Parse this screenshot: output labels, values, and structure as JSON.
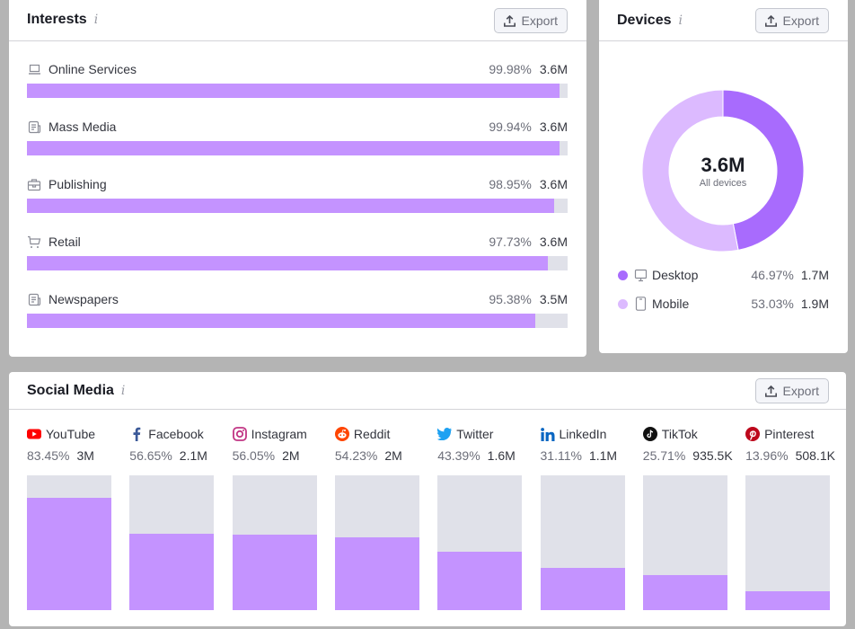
{
  "colors": {
    "bar_fill": "#c493ff",
    "bar_track": "#e0e1e9",
    "desktop": "#a86bfd",
    "mobile": "#dcbaff"
  },
  "interests": {
    "title": "Interests",
    "info_icon": "info-icon",
    "export_label": "Export",
    "items": [
      {
        "label": "Online Services",
        "icon": "laptop-icon",
        "percent": "99.98%",
        "value": "3.6M",
        "share": 99.98
      },
      {
        "label": "Mass Media",
        "icon": "news-icon",
        "percent": "99.94%",
        "value": "3.6M",
        "share": 99.94
      },
      {
        "label": "Publishing",
        "icon": "briefcase-icon",
        "percent": "98.95%",
        "value": "3.6M",
        "share": 98.95
      },
      {
        "label": "Retail",
        "icon": "cart-icon",
        "percent": "97.73%",
        "value": "3.6M",
        "share": 97.73
      },
      {
        "label": "Newspapers",
        "icon": "news-icon",
        "percent": "95.38%",
        "value": "3.5M",
        "share": 95.38
      }
    ]
  },
  "devices": {
    "title": "Devices",
    "info_icon": "info-icon",
    "export_label": "Export",
    "total": "3.6M",
    "total_label": "All devices",
    "items": [
      {
        "label": "Desktop",
        "icon": "desktop-icon",
        "percent": "46.97%",
        "value": "1.7M",
        "share": 46.97,
        "color": "#a86bfd"
      },
      {
        "label": "Mobile",
        "icon": "mobile-icon",
        "percent": "53.03%",
        "value": "1.9M",
        "share": 53.03,
        "color": "#dcbaff"
      }
    ]
  },
  "social": {
    "title": "Social Media",
    "info_icon": "info-icon",
    "export_label": "Export",
    "items": [
      {
        "label": "YouTube",
        "icon": "youtube-icon",
        "percent": "83.45%",
        "value": "3M",
        "share": 83.45
      },
      {
        "label": "Facebook",
        "icon": "facebook-icon",
        "percent": "56.65%",
        "value": "2.1M",
        "share": 56.65
      },
      {
        "label": "Instagram",
        "icon": "instagram-icon",
        "percent": "56.05%",
        "value": "2M",
        "share": 56.05
      },
      {
        "label": "Reddit",
        "icon": "reddit-icon",
        "percent": "54.23%",
        "value": "2M",
        "share": 54.23
      },
      {
        "label": "Twitter",
        "icon": "twitter-icon",
        "percent": "43.39%",
        "value": "1.6M",
        "share": 43.39
      },
      {
        "label": "LinkedIn",
        "icon": "linkedin-icon",
        "percent": "31.11%",
        "value": "1.1M",
        "share": 31.11
      },
      {
        "label": "TikTok",
        "icon": "tiktok-icon",
        "percent": "25.71%",
        "value": "935.5K",
        "share": 25.71
      },
      {
        "label": "Pinterest",
        "icon": "pinterest-icon",
        "percent": "13.96%",
        "value": "508.1K",
        "share": 13.96
      }
    ]
  }
}
